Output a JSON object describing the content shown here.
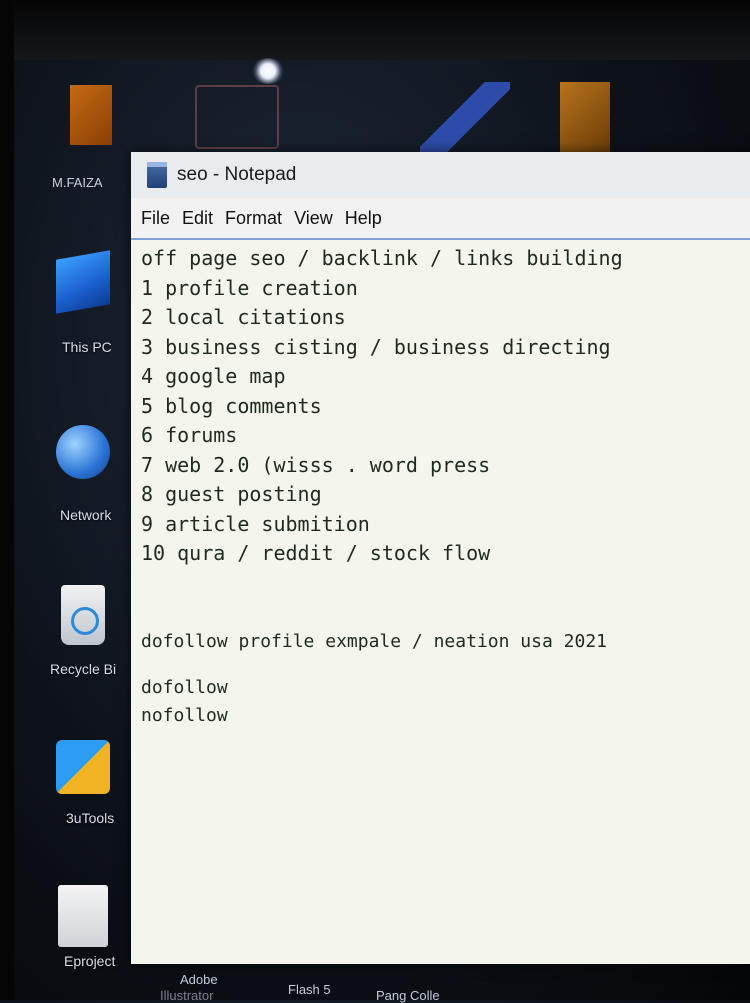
{
  "desktop": {
    "top_label": "M.FAIZA",
    "icons": [
      {
        "label": "This PC",
        "icon": "computer-icon"
      },
      {
        "label": "Network",
        "icon": "network-icon"
      },
      {
        "label": "Recycle Bi",
        "icon": "recycle-bin-icon"
      },
      {
        "label": "3uTools",
        "icon": "tools-icon"
      },
      {
        "label": "Eproject",
        "icon": "document-icon"
      }
    ],
    "taskbar_labels": [
      "Adobe",
      "Illustrator",
      "Flash 5",
      "Pang Colle"
    ]
  },
  "window": {
    "title": "seo - Notepad",
    "menu": [
      "File",
      "Edit",
      "Format",
      "View",
      "Help"
    ],
    "lines": [
      "off page seo / backlink / links building",
      "1 profile creation",
      "2 local citations",
      "3 business cisting / business directing",
      "4 google map",
      "5 blog comments",
      "6 forums",
      "7 web 2.0 (wisss . word press",
      "8 guest posting",
      "9 article submition",
      "10 qura / reddit / stock flow",
      "",
      "",
      "dofollow profile exmpale / neation usa 2021",
      "",
      "dofollow",
      "nofollow"
    ]
  }
}
